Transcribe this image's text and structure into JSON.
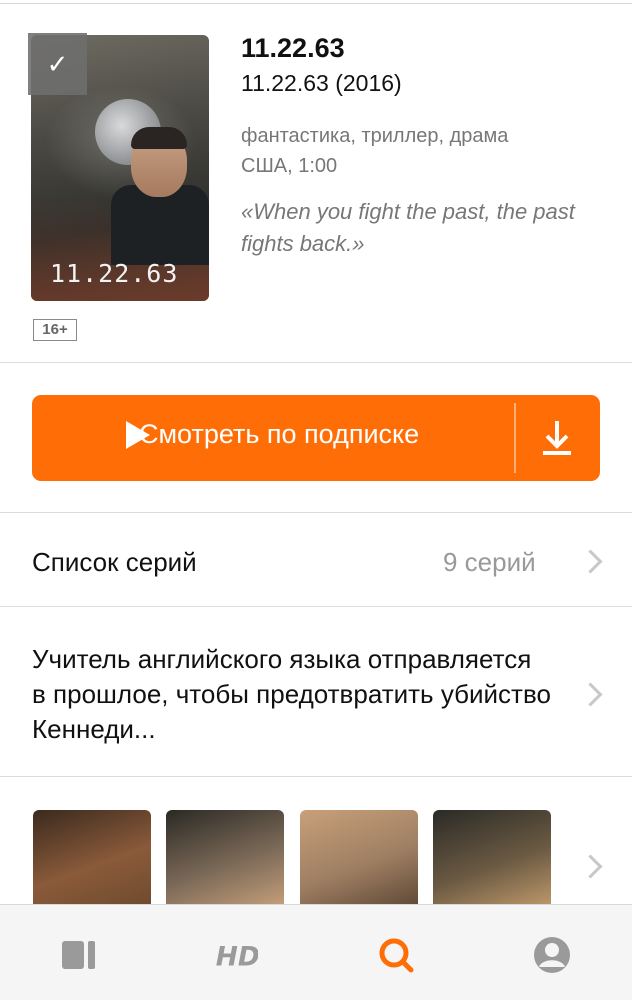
{
  "film": {
    "title": "11.22.63",
    "original_title": "11.22.63 (2016)",
    "genres": "фантастика, триллер, драма",
    "country_duration": "США, 1:00",
    "tagline": "«When you fight the past, the past fights back.»",
    "age_rating": "16+",
    "poster_text": "11.22.63"
  },
  "watch_button": {
    "label": "Смотреть по подписке"
  },
  "episodes": {
    "label": "Список серий",
    "count": "9 серий"
  },
  "description": "Учитель английского языка отправляется в прошлое, чтобы предотвратить убийство Кеннеди...",
  "tabs": [
    {
      "name": "catalog",
      "icon": "library-icon",
      "active": false
    },
    {
      "name": "hd",
      "icon": "hd-icon",
      "active": false
    },
    {
      "name": "search",
      "icon": "search-icon",
      "active": true
    },
    {
      "name": "profile",
      "icon": "profile-icon",
      "active": false
    }
  ],
  "colors": {
    "accent": "#ff6e06",
    "tab_inactive": "#9a9a9a",
    "text_secondary": "#777777"
  }
}
